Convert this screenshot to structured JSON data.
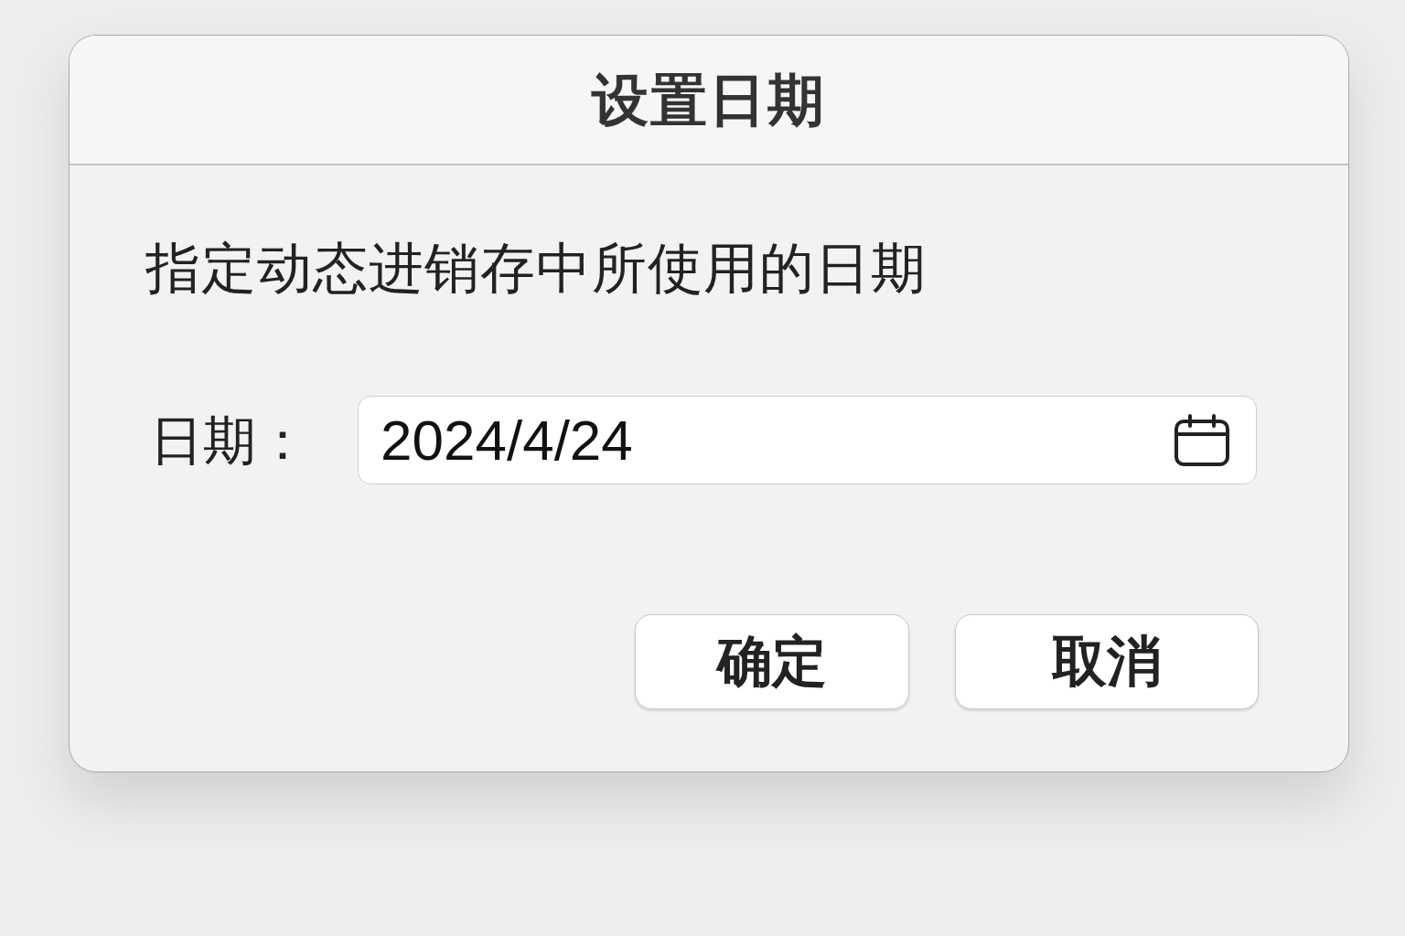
{
  "window": {
    "title": "设置日期"
  },
  "description": "指定动态进销存中所使用的日期",
  "date_field": {
    "label": "日期：",
    "value": "2024/4/24"
  },
  "buttons": [
    "确定",
    "取消"
  ]
}
